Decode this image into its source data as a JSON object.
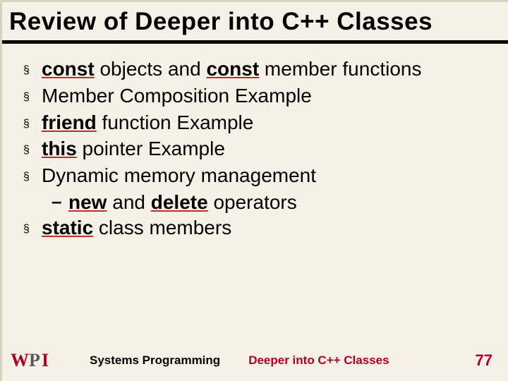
{
  "title": "Review of Deeper into C++ Classes",
  "bullets": {
    "b1": {
      "pre": "const",
      "mid1": " objects and ",
      "kw2": "const",
      "post": " member functions"
    },
    "b2": {
      "text": "Member Composition Example"
    },
    "b3": {
      "kw": "friend",
      "post": " function Example"
    },
    "b4": {
      "kw": "this",
      "post": " pointer Example"
    },
    "b5": {
      "text": "Dynamic memory management"
    },
    "b5sub": {
      "kw1": "new",
      "mid": " and ",
      "kw2": "delete",
      "post": " operators"
    },
    "b6": {
      "kw": "static",
      "post": " class members"
    }
  },
  "footer": {
    "center1": "Systems Programming",
    "center2": "Deeper into C++ Classes",
    "page": "77"
  },
  "glyphs": {
    "bullet": "§",
    "dash": "–"
  },
  "logo_text": "WPI"
}
